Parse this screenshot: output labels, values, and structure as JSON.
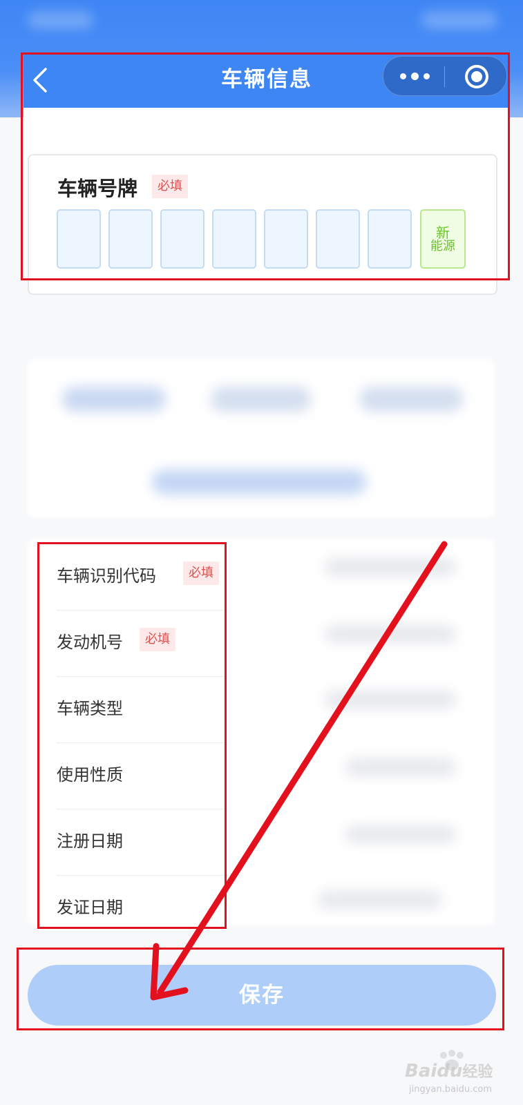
{
  "navbar": {
    "title": "车辆信息",
    "bg_color": "#3f86f5"
  },
  "plate": {
    "title": "车辆号牌",
    "required_tag": "必填",
    "new_energy_label_line1": "新",
    "new_energy_label_line2": "能源"
  },
  "form": {
    "rows": [
      {
        "label": "车辆识别代码",
        "required": "必填"
      },
      {
        "label": "发动机号",
        "required": "必填"
      },
      {
        "label": "车辆类型"
      },
      {
        "label": "使用性质"
      },
      {
        "label": "注册日期"
      },
      {
        "label": "发证日期"
      }
    ]
  },
  "save_button": {
    "label": "保存",
    "color": "#aecdf9"
  },
  "annotation_color": "#e3101d",
  "watermark": {
    "brand": "Baidu",
    "brand_cn": "经验",
    "site": "jingyan.baidu.com"
  }
}
